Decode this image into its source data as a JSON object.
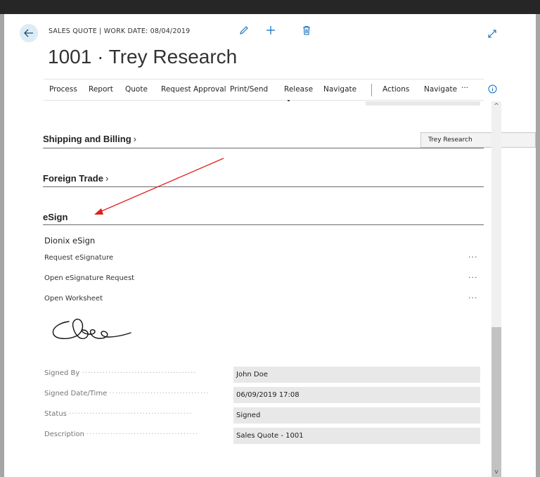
{
  "header": {
    "caption": "SALES QUOTE | WORK DATE: 08/04/2019",
    "title": "1001 · Trey Research"
  },
  "actions": [
    "Process",
    "Report",
    "Quote",
    "Request Approval",
    "Print/Send",
    "Release",
    "Navigate",
    "Actions",
    "Navigate"
  ],
  "more_label": "···",
  "sections": {
    "shipping": {
      "title": "Shipping and Billing",
      "summary": "Trey Research"
    },
    "foreign": {
      "title": "Foreign Trade"
    },
    "esign": {
      "title": "eSign"
    }
  },
  "chevron": "›",
  "esign": {
    "group": "Dionix eSign",
    "links": [
      "Request eSignature",
      "Open eSignature Request",
      "Open Worksheet"
    ],
    "ellipsis": "···",
    "fields": [
      {
        "label": "Signed By",
        "value": "John Doe"
      },
      {
        "label": "Signed Date/Time",
        "value": "06/09/2019 17:08"
      },
      {
        "label": "Status",
        "value": "Signed"
      },
      {
        "label": "Description",
        "value": "Sales Quote - 1001"
      }
    ]
  },
  "colors": {
    "accent": "#0078d4",
    "annotation_arrow": "#e0201c",
    "back_button_bg": "#dcecf5"
  },
  "icons": {
    "back": "back-arrow-icon",
    "edit": "pencil-icon",
    "new": "plus-icon",
    "delete": "trash-icon",
    "expand": "expand-icon",
    "info": "info-icon"
  }
}
